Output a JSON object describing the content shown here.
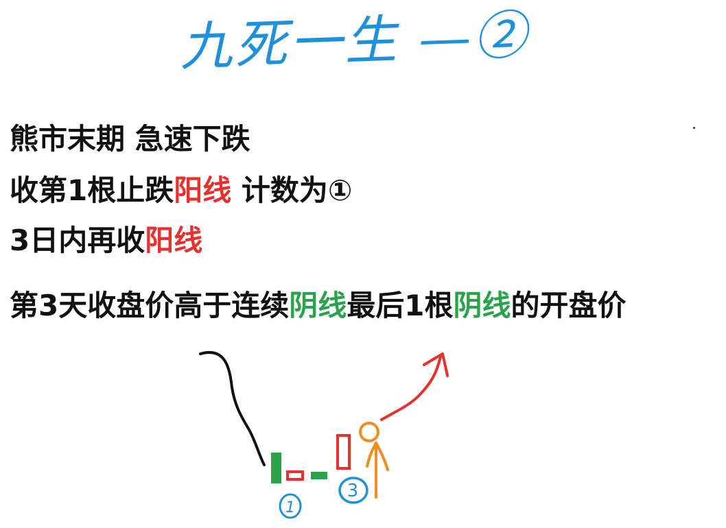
{
  "title": {
    "text": "九死一生 —②"
  },
  "lines": [
    {
      "segments": [
        {
          "text": "熊市末期 急速下跌",
          "color": "black"
        }
      ]
    },
    {
      "segments": [
        {
          "text": "收第1根止跌",
          "color": "black"
        },
        {
          "text": "阳线",
          "color": "red"
        },
        {
          "text": " 计数为①",
          "color": "black"
        }
      ]
    },
    {
      "segments": [
        {
          "text": "3日内再收",
          "color": "black"
        },
        {
          "text": "阳线",
          "color": "red"
        }
      ]
    },
    {
      "segments": [
        {
          "text": "第3天收盘价高于连续",
          "color": "black"
        },
        {
          "text": "阴线",
          "color": "green"
        },
        {
          "text": "最后1根",
          "color": "black"
        },
        {
          "text": "阴线",
          "color": "green"
        },
        {
          "text": "的开盘价",
          "color": "black"
        }
      ]
    }
  ],
  "sketch": {
    "marker_1": "1",
    "marker_3": "3"
  },
  "colors": {
    "handwriting_blue": "#1e90dc",
    "yang_red": "#e8302c",
    "yin_green": "#2aa34a",
    "figure_orange": "#f28c1e",
    "trend_black": "#111111"
  }
}
